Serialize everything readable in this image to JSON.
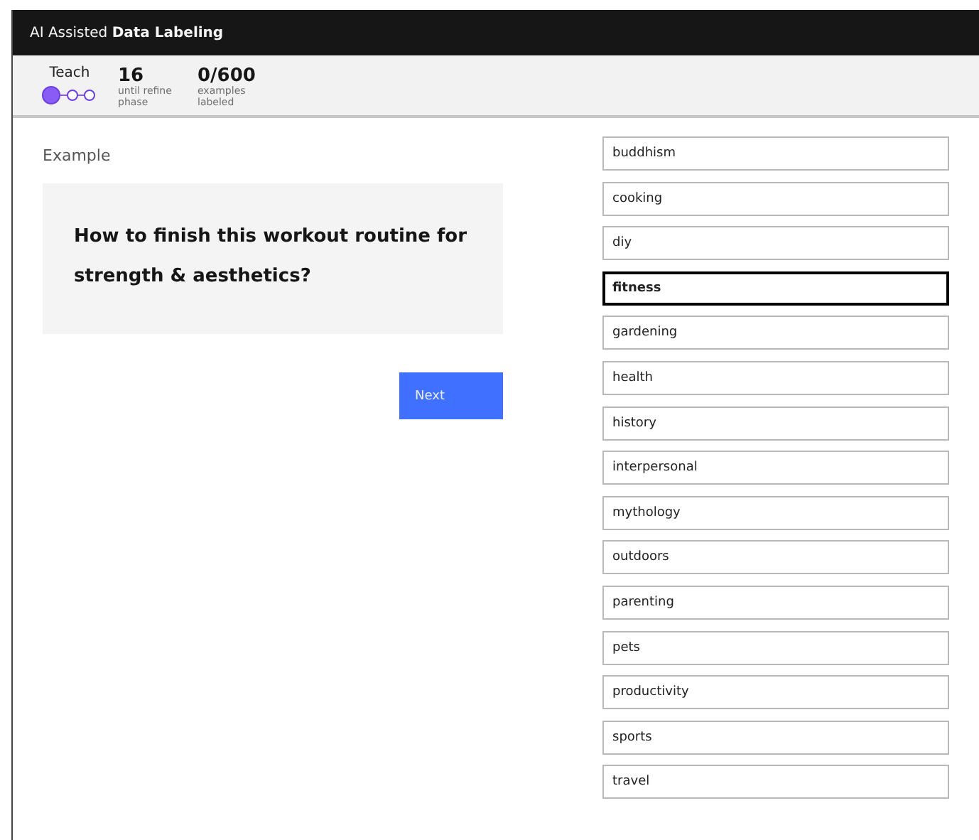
{
  "app_title": {
    "prefix": "AI Assisted",
    "name": "Data Labeling"
  },
  "status": {
    "phase": "Teach",
    "phase_steps": [
      {
        "selected": true
      },
      {
        "selected": false
      },
      {
        "selected": false
      }
    ],
    "stats": [
      {
        "value": "16",
        "caption": "until refine phase"
      },
      {
        "value": "0/600",
        "caption": "examples labeled"
      }
    ]
  },
  "example": {
    "heading": "Example",
    "text": "How to finish this workout routine for strength & aesthetics?"
  },
  "next_button": "Next",
  "labels": [
    {
      "label": "buddhism",
      "selected": false
    },
    {
      "label": "cooking",
      "selected": false
    },
    {
      "label": "diy",
      "selected": false
    },
    {
      "label": "fitness",
      "selected": true
    },
    {
      "label": "gardening",
      "selected": false
    },
    {
      "label": "health",
      "selected": false
    },
    {
      "label": "history",
      "selected": false
    },
    {
      "label": "interpersonal",
      "selected": false
    },
    {
      "label": "mythology",
      "selected": false
    },
    {
      "label": "outdoors",
      "selected": false
    },
    {
      "label": "parenting",
      "selected": false
    },
    {
      "label": "pets",
      "selected": false
    },
    {
      "label": "productivity",
      "selected": false
    },
    {
      "label": "sports",
      "selected": false
    },
    {
      "label": "travel",
      "selected": false
    }
  ]
}
